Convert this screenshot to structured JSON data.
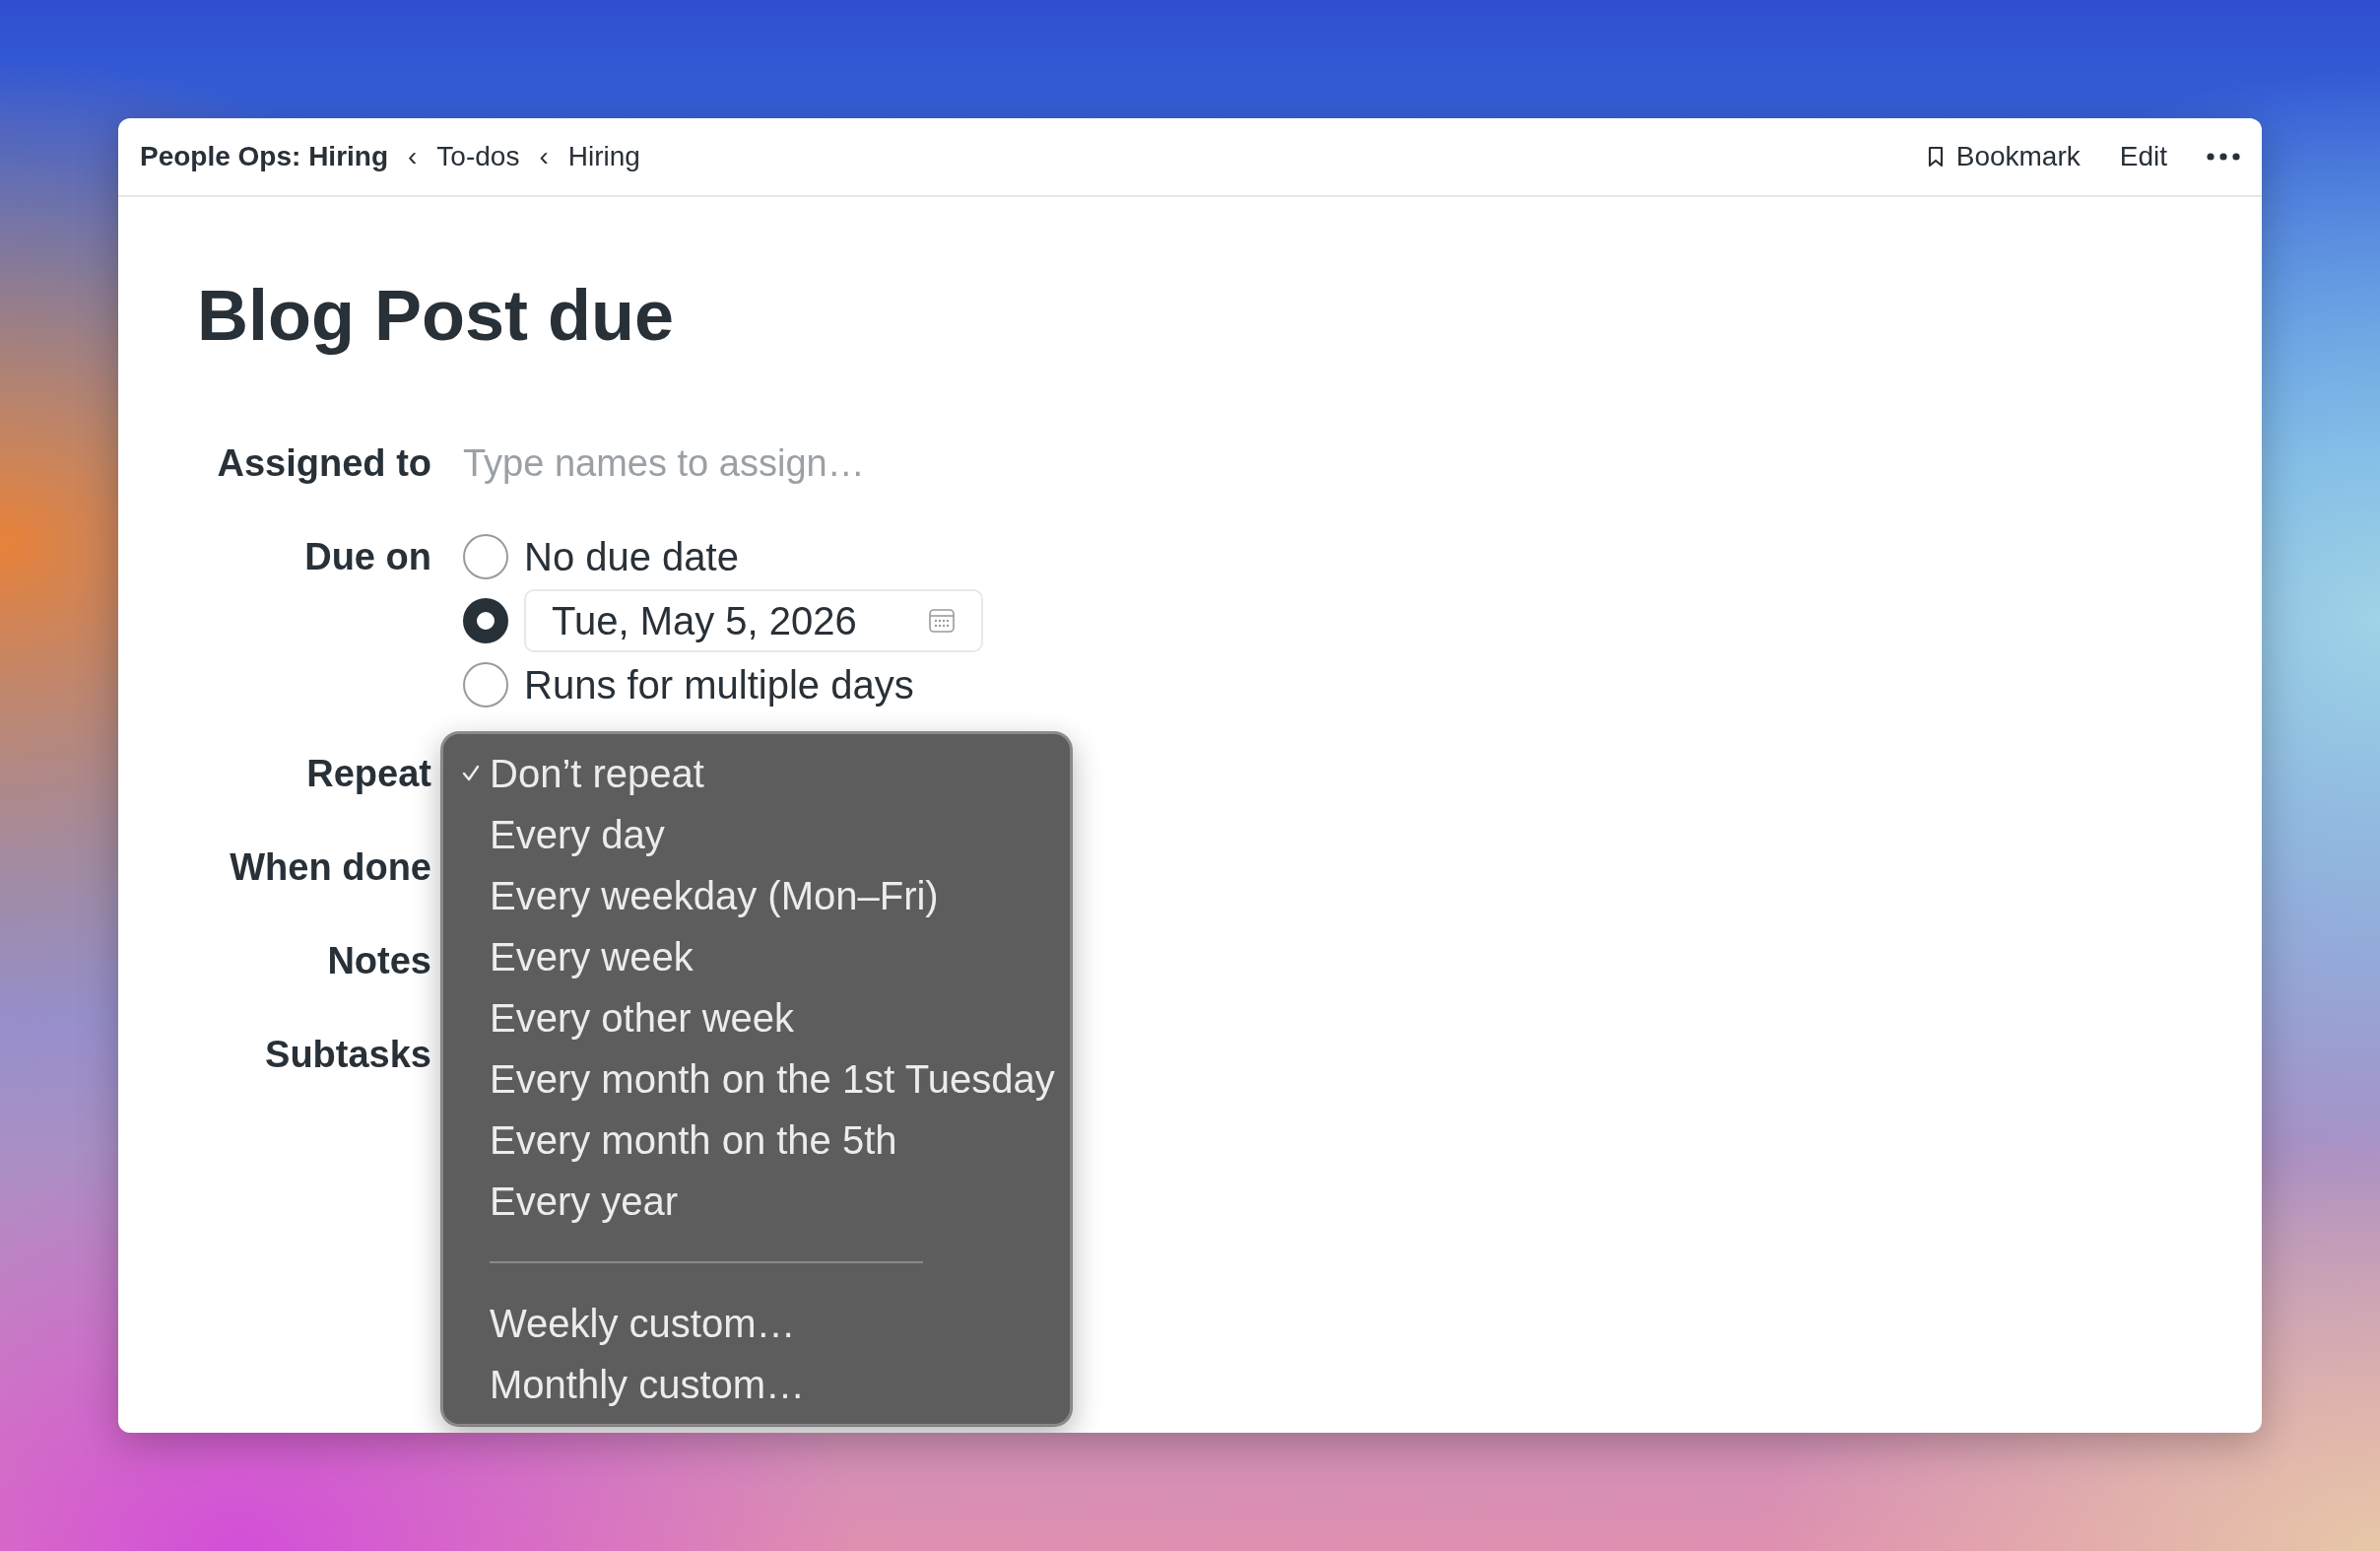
{
  "breadcrumbs": [
    {
      "label": "People Ops: Hiring",
      "kind": "current"
    },
    {
      "label": "To-dos",
      "kind": "link",
      "prefix": "‹"
    },
    {
      "label": "Hiring",
      "kind": "link",
      "prefix": "‹"
    }
  ],
  "header_actions": [
    {
      "kind": "bookmark",
      "label": "Bookmark"
    },
    {
      "kind": "text",
      "label": "Edit"
    },
    {
      "kind": "more"
    }
  ],
  "title": "Blog Post due",
  "fields": [
    {
      "label": "Assigned to",
      "kind": "input",
      "placeholder": "Type names to assign…"
    },
    {
      "label": "Due on",
      "kind": "due",
      "options": [
        {
          "kind": "text",
          "label": "No due date",
          "selected": false
        },
        {
          "kind": "date",
          "value": "Tue, May 5, 2026",
          "selected": true
        },
        {
          "kind": "text",
          "label": "Runs for multiple days",
          "selected": false
        }
      ]
    },
    {
      "label": "Repeat",
      "kind": "menu"
    },
    {
      "label": "When done",
      "kind": "hidden"
    },
    {
      "label": "Notes",
      "kind": "hidden"
    },
    {
      "label": "Subtasks",
      "kind": "hidden"
    }
  ],
  "repeat_menu": {
    "items": [
      {
        "kind": "option",
        "label": "Don’t repeat",
        "checked": true
      },
      {
        "kind": "option",
        "label": "Every day",
        "checked": false
      },
      {
        "kind": "option",
        "label": "Every weekday (Mon–Fri)",
        "checked": false
      },
      {
        "kind": "option",
        "label": "Every week",
        "checked": false
      },
      {
        "kind": "option",
        "label": "Every other week",
        "checked": false
      },
      {
        "kind": "option",
        "label": "Every month on the 1st Tuesday",
        "checked": false
      },
      {
        "kind": "option",
        "label": "Every month on the 5th",
        "checked": false
      },
      {
        "kind": "option",
        "label": "Every year",
        "checked": false
      },
      {
        "kind": "separator"
      },
      {
        "kind": "option",
        "label": "Weekly custom…",
        "checked": false
      },
      {
        "kind": "option",
        "label": "Monthly custom…",
        "checked": false
      }
    ]
  }
}
